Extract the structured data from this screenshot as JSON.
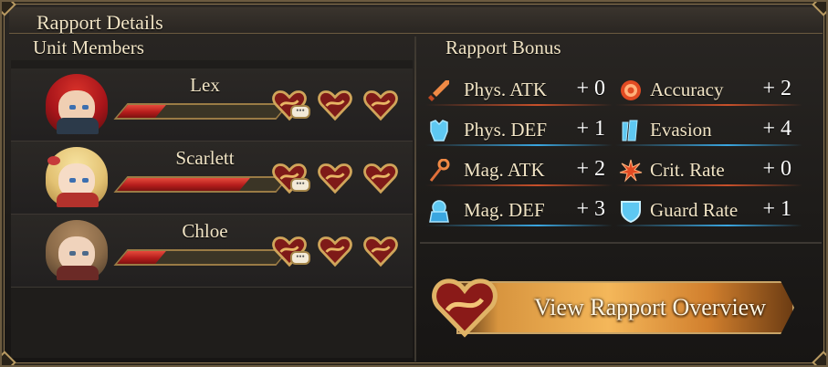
{
  "window": {
    "title": "Rapport Details"
  },
  "unit_members": {
    "heading": "Unit Members",
    "members": [
      {
        "name": "Lex",
        "rapport_fill": 0.24,
        "hearts": 3
      },
      {
        "name": "Scarlett",
        "rapport_fill": 0.77,
        "hearts": 3
      },
      {
        "name": "Chloe",
        "rapport_fill": 0.24,
        "hearts": 3
      }
    ]
  },
  "rapport_bonus": {
    "heading": "Rapport Bonus",
    "left": [
      {
        "label": "Phys. ATK",
        "value": "+ 0",
        "icon": "sword-icon",
        "accent": "#c8502a"
      },
      {
        "label": "Phys. DEF",
        "value": "+ 1",
        "icon": "armor-icon",
        "accent": "#3aa6e0"
      },
      {
        "label": "Mag. ATK",
        "value": "+ 2",
        "icon": "staff-icon",
        "accent": "#c8502a"
      },
      {
        "label": "Mag. DEF",
        "value": "+ 3",
        "icon": "robe-icon",
        "accent": "#3aa6e0"
      }
    ],
    "right": [
      {
        "label": "Accuracy",
        "value": "+ 2",
        "icon": "target-icon",
        "accent": "#c8502a"
      },
      {
        "label": "Evasion",
        "value": "+ 4",
        "icon": "evasion-icon",
        "accent": "#3aa6e0"
      },
      {
        "label": "Crit. Rate",
        "value": "+ 0",
        "icon": "crit-icon",
        "accent": "#c8502a"
      },
      {
        "label": "Guard Rate",
        "value": "+ 1",
        "icon": "shield-icon",
        "accent": "#3aa6e0"
      }
    ]
  },
  "button": {
    "label": "View Rapport Overview"
  },
  "colors": {
    "text": "#f1e4c5",
    "bar_red": "#c0251f",
    "frame_gold": "#9a7b45",
    "physical_accent": "#c8502a",
    "defense_accent": "#3aa6e0"
  }
}
